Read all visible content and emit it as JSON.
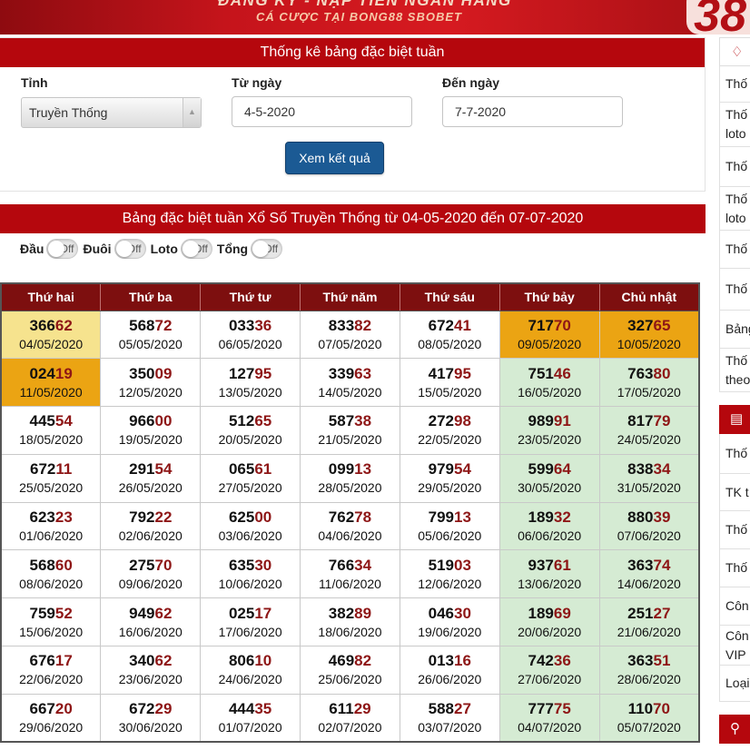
{
  "banner": {
    "line1": "ĐĂNG KÝ - NẠP TIỀN NGÂN HÀNG",
    "line2": "CÁ CƯỢC TẠI BONG88 SBOBET",
    "logo": "38"
  },
  "filter": {
    "title": "Thống kê bảng đặc biệt tuần",
    "province_label": "Tỉnh",
    "province_value": "Truyền Thống",
    "from_label": "Từ ngày",
    "from_value": "4-5-2020",
    "to_label": "Đến ngày",
    "to_value": "7-7-2020",
    "submit": "Xem kết quả"
  },
  "results": {
    "title": "Bảng đặc biệt tuần Xổ Số Truyền Thống từ 04-05-2020 đến 07-07-2020",
    "toggles": [
      {
        "label": "Đầu",
        "state": "Off"
      },
      {
        "label": "Đuôi",
        "state": "Off"
      },
      {
        "label": "Loto",
        "state": "Off"
      },
      {
        "label": "Tổng",
        "state": "Off"
      }
    ],
    "headers": [
      "Thứ hai",
      "Thứ ba",
      "Thứ tư",
      "Thứ năm",
      "Thứ sáu",
      "Thứ bảy",
      "Chủ nhật"
    ],
    "highlight_colors": {
      "light": "#f6e38e",
      "orange": "#eba413",
      "weekend": "#d5ebd3",
      "tail": "#8e1616"
    },
    "rows": [
      [
        {
          "head": "366",
          "tail": "62",
          "date": "04/05/2020",
          "hl": "light"
        },
        {
          "head": "568",
          "tail": "72",
          "date": "05/05/2020"
        },
        {
          "head": "033",
          "tail": "36",
          "date": "06/05/2020"
        },
        {
          "head": "833",
          "tail": "82",
          "date": "07/05/2020"
        },
        {
          "head": "672",
          "tail": "41",
          "date": "08/05/2020"
        },
        {
          "head": "717",
          "tail": "70",
          "date": "09/05/2020",
          "hl": "orange"
        },
        {
          "head": "327",
          "tail": "65",
          "date": "10/05/2020",
          "hl": "orange"
        }
      ],
      [
        {
          "head": "024",
          "tail": "19",
          "date": "11/05/2020",
          "hl": "orange"
        },
        {
          "head": "350",
          "tail": "09",
          "date": "12/05/2020"
        },
        {
          "head": "127",
          "tail": "95",
          "date": "13/05/2020"
        },
        {
          "head": "339",
          "tail": "63",
          "date": "14/05/2020"
        },
        {
          "head": "417",
          "tail": "95",
          "date": "15/05/2020"
        },
        {
          "head": "751",
          "tail": "46",
          "date": "16/05/2020"
        },
        {
          "head": "763",
          "tail": "80",
          "date": "17/05/2020"
        }
      ],
      [
        {
          "head": "445",
          "tail": "54",
          "date": "18/05/2020"
        },
        {
          "head": "966",
          "tail": "00",
          "date": "19/05/2020"
        },
        {
          "head": "512",
          "tail": "65",
          "date": "20/05/2020"
        },
        {
          "head": "587",
          "tail": "38",
          "date": "21/05/2020"
        },
        {
          "head": "272",
          "tail": "98",
          "date": "22/05/2020"
        },
        {
          "head": "989",
          "tail": "91",
          "date": "23/05/2020"
        },
        {
          "head": "817",
          "tail": "79",
          "date": "24/05/2020"
        }
      ],
      [
        {
          "head": "672",
          "tail": "11",
          "date": "25/05/2020"
        },
        {
          "head": "291",
          "tail": "54",
          "date": "26/05/2020"
        },
        {
          "head": "065",
          "tail": "61",
          "date": "27/05/2020"
        },
        {
          "head": "099",
          "tail": "13",
          "date": "28/05/2020"
        },
        {
          "head": "979",
          "tail": "54",
          "date": "29/05/2020"
        },
        {
          "head": "599",
          "tail": "64",
          "date": "30/05/2020"
        },
        {
          "head": "838",
          "tail": "34",
          "date": "31/05/2020"
        }
      ],
      [
        {
          "head": "623",
          "tail": "23",
          "date": "01/06/2020"
        },
        {
          "head": "792",
          "tail": "22",
          "date": "02/06/2020"
        },
        {
          "head": "625",
          "tail": "00",
          "date": "03/06/2020"
        },
        {
          "head": "762",
          "tail": "78",
          "date": "04/06/2020"
        },
        {
          "head": "799",
          "tail": "13",
          "date": "05/06/2020"
        },
        {
          "head": "189",
          "tail": "32",
          "date": "06/06/2020"
        },
        {
          "head": "880",
          "tail": "39",
          "date": "07/06/2020"
        }
      ],
      [
        {
          "head": "568",
          "tail": "60",
          "date": "08/06/2020"
        },
        {
          "head": "275",
          "tail": "70",
          "date": "09/06/2020"
        },
        {
          "head": "635",
          "tail": "30",
          "date": "10/06/2020"
        },
        {
          "head": "766",
          "tail": "34",
          "date": "11/06/2020"
        },
        {
          "head": "519",
          "tail": "03",
          "date": "12/06/2020"
        },
        {
          "head": "937",
          "tail": "61",
          "date": "13/06/2020"
        },
        {
          "head": "363",
          "tail": "74",
          "date": "14/06/2020"
        }
      ],
      [
        {
          "head": "759",
          "tail": "52",
          "date": "15/06/2020"
        },
        {
          "head": "949",
          "tail": "62",
          "date": "16/06/2020"
        },
        {
          "head": "025",
          "tail": "17",
          "date": "17/06/2020"
        },
        {
          "head": "382",
          "tail": "89",
          "date": "18/06/2020"
        },
        {
          "head": "046",
          "tail": "30",
          "date": "19/06/2020"
        },
        {
          "head": "189",
          "tail": "69",
          "date": "20/06/2020"
        },
        {
          "head": "251",
          "tail": "27",
          "date": "21/06/2020"
        }
      ],
      [
        {
          "head": "676",
          "tail": "17",
          "date": "22/06/2020"
        },
        {
          "head": "340",
          "tail": "62",
          "date": "23/06/2020"
        },
        {
          "head": "806",
          "tail": "10",
          "date": "24/06/2020"
        },
        {
          "head": "469",
          "tail": "82",
          "date": "25/06/2020"
        },
        {
          "head": "013",
          "tail": "16",
          "date": "26/06/2020"
        },
        {
          "head": "742",
          "tail": "36",
          "date": "27/06/2020"
        },
        {
          "head": "363",
          "tail": "51",
          "date": "28/06/2020"
        }
      ],
      [
        {
          "head": "667",
          "tail": "20",
          "date": "29/06/2020"
        },
        {
          "head": "672",
          "tail": "29",
          "date": "30/06/2020"
        },
        {
          "head": "444",
          "tail": "35",
          "date": "01/07/2020"
        },
        {
          "head": "611",
          "tail": "29",
          "date": "02/07/2020"
        },
        {
          "head": "588",
          "tail": "27",
          "date": "03/07/2020"
        },
        {
          "head": "777",
          "tail": "75",
          "date": "04/07/2020"
        },
        {
          "head": "110",
          "tail": "70",
          "date": "05/07/2020"
        }
      ]
    ]
  },
  "sidebar": {
    "head1_icon": "diamond-icon",
    "items1": [
      "Thố",
      "Thố\nloto",
      "Thố",
      "Thố\nloto",
      "Thố",
      "Thố",
      "Bảng",
      "Thố\ntheo"
    ],
    "head2_icon": "bar-chart-icon",
    "items2": [
      "Thố",
      "TK t",
      "Thố",
      "Thố",
      "Côn",
      "Côn\nVIP",
      "Loại"
    ],
    "head3_icon": "search-icon"
  }
}
